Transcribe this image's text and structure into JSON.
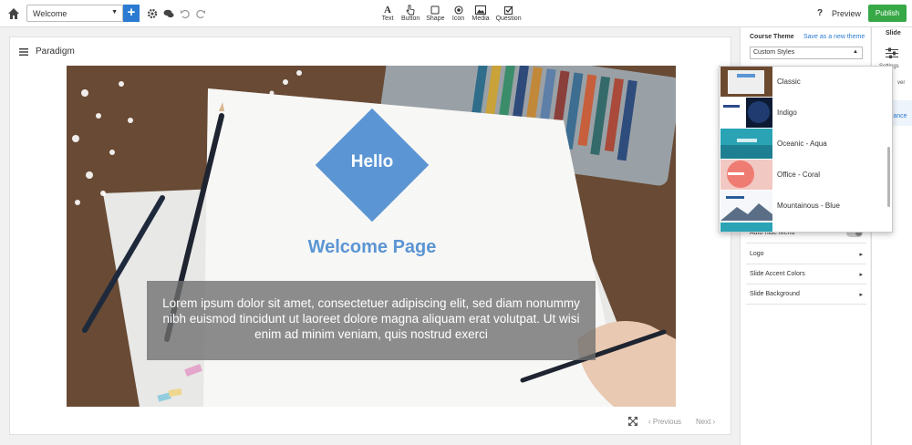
{
  "toolbar": {
    "slide_select": "Welcome",
    "add_label": "+",
    "tools": [
      {
        "label": "Text",
        "icon": "text-icon"
      },
      {
        "label": "Button",
        "icon": "hand-pointer-icon"
      },
      {
        "label": "Shape",
        "icon": "square-icon"
      },
      {
        "label": "Icon",
        "icon": "circle-dot-icon"
      },
      {
        "label": "Media",
        "icon": "image-icon"
      },
      {
        "label": "Question",
        "icon": "checkbox-icon"
      }
    ],
    "help": "?",
    "preview": "Preview",
    "publish": "Publish"
  },
  "canvas": {
    "course_title": "Paradigm",
    "hello": "Hello",
    "welcome": "Welcome Page",
    "lorem": "Lorem ipsum dolor sit amet, consectetuer adipiscing elit, sed diam nonummy nibh euismod tincidunt ut laoreet dolore magna aliquam erat volutpat. Ut wisi enim ad minim veniam, quis nostrud exerci",
    "prev": "Previous",
    "next": "Next"
  },
  "panel": {
    "course_theme": "Course Theme",
    "save_theme": "Save as a new theme",
    "theme_selected": "Custom Styles",
    "rows": [
      {
        "label": "Auto-hide Menu"
      },
      {
        "label": "Logo"
      },
      {
        "label": "Slide Accent Colors"
      },
      {
        "label": "Slide Background"
      }
    ]
  },
  "rail": {
    "title": "Slide",
    "settings": "Settings",
    "cover": "ver",
    "appearance": "rance"
  },
  "themes": [
    "Classic",
    "Indigo",
    "Oceanic - Aqua",
    "Office - Coral",
    "Mountainous - Blue"
  ],
  "colors": {
    "accent": "#5b95d3",
    "publish": "#37a846",
    "link": "#2a7bd1"
  }
}
